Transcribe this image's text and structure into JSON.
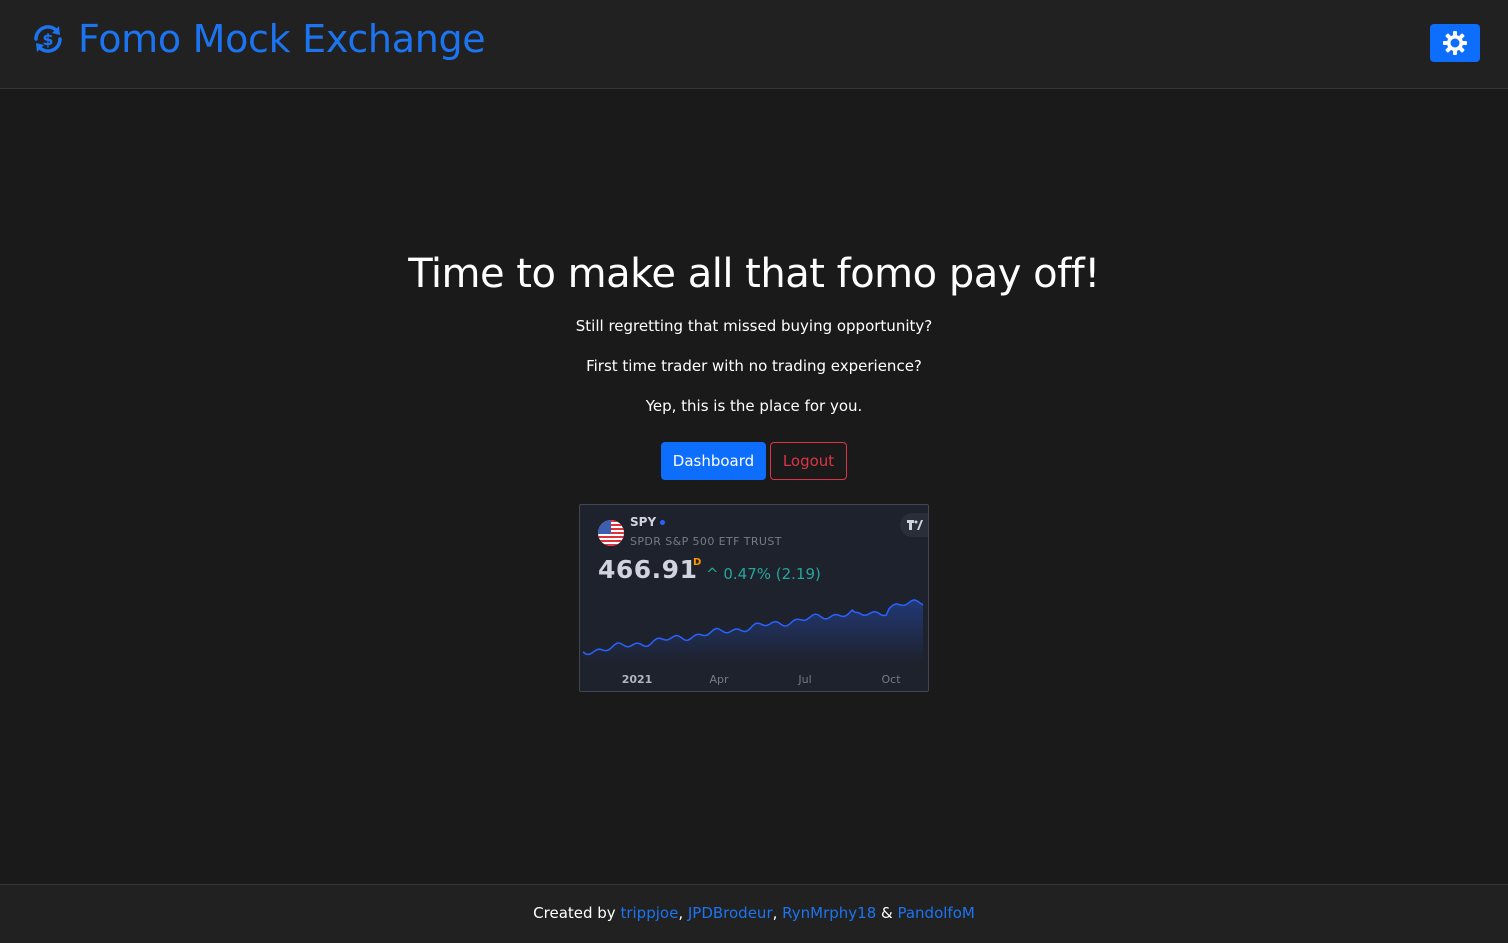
{
  "header": {
    "brand_name": "Fomo Mock Exchange",
    "brand_icon": "dollar-sync-icon",
    "theme_toggle_icon": "sun-gear-icon"
  },
  "hero": {
    "title": "Time to make all that fomo pay off!",
    "line1": "Still regretting that missed buying opportunity?",
    "line2": "First time trader with no trading experience?",
    "line3": "Yep, this is the place for you."
  },
  "actions": {
    "dashboard_label": "Dashboard",
    "logout_label": "Logout"
  },
  "widget": {
    "symbol": "SPY",
    "description": "SPDR S&P 500 ETF TRUST",
    "price": "466.91",
    "period": "D",
    "change": "^ 0.47% (2.19)",
    "line_color": "#2962ff",
    "x_labels": [
      "2021",
      "Apr",
      "Jul",
      "Oct"
    ]
  },
  "footer": {
    "prefix": "Created by ",
    "authors": [
      "trippjoe",
      "JPDBrodeur",
      "RynMrphy18",
      "PandolfoM"
    ],
    "sep1": ", ",
    "sep2": ", ",
    "sep3": " & "
  },
  "colors": {
    "accent": "#1c74f0",
    "primary_button": "#0d6efd",
    "danger": "#dc3545",
    "background": "#1a1a1b",
    "navbar": "#212121",
    "positive_change": "#26a69a"
  }
}
